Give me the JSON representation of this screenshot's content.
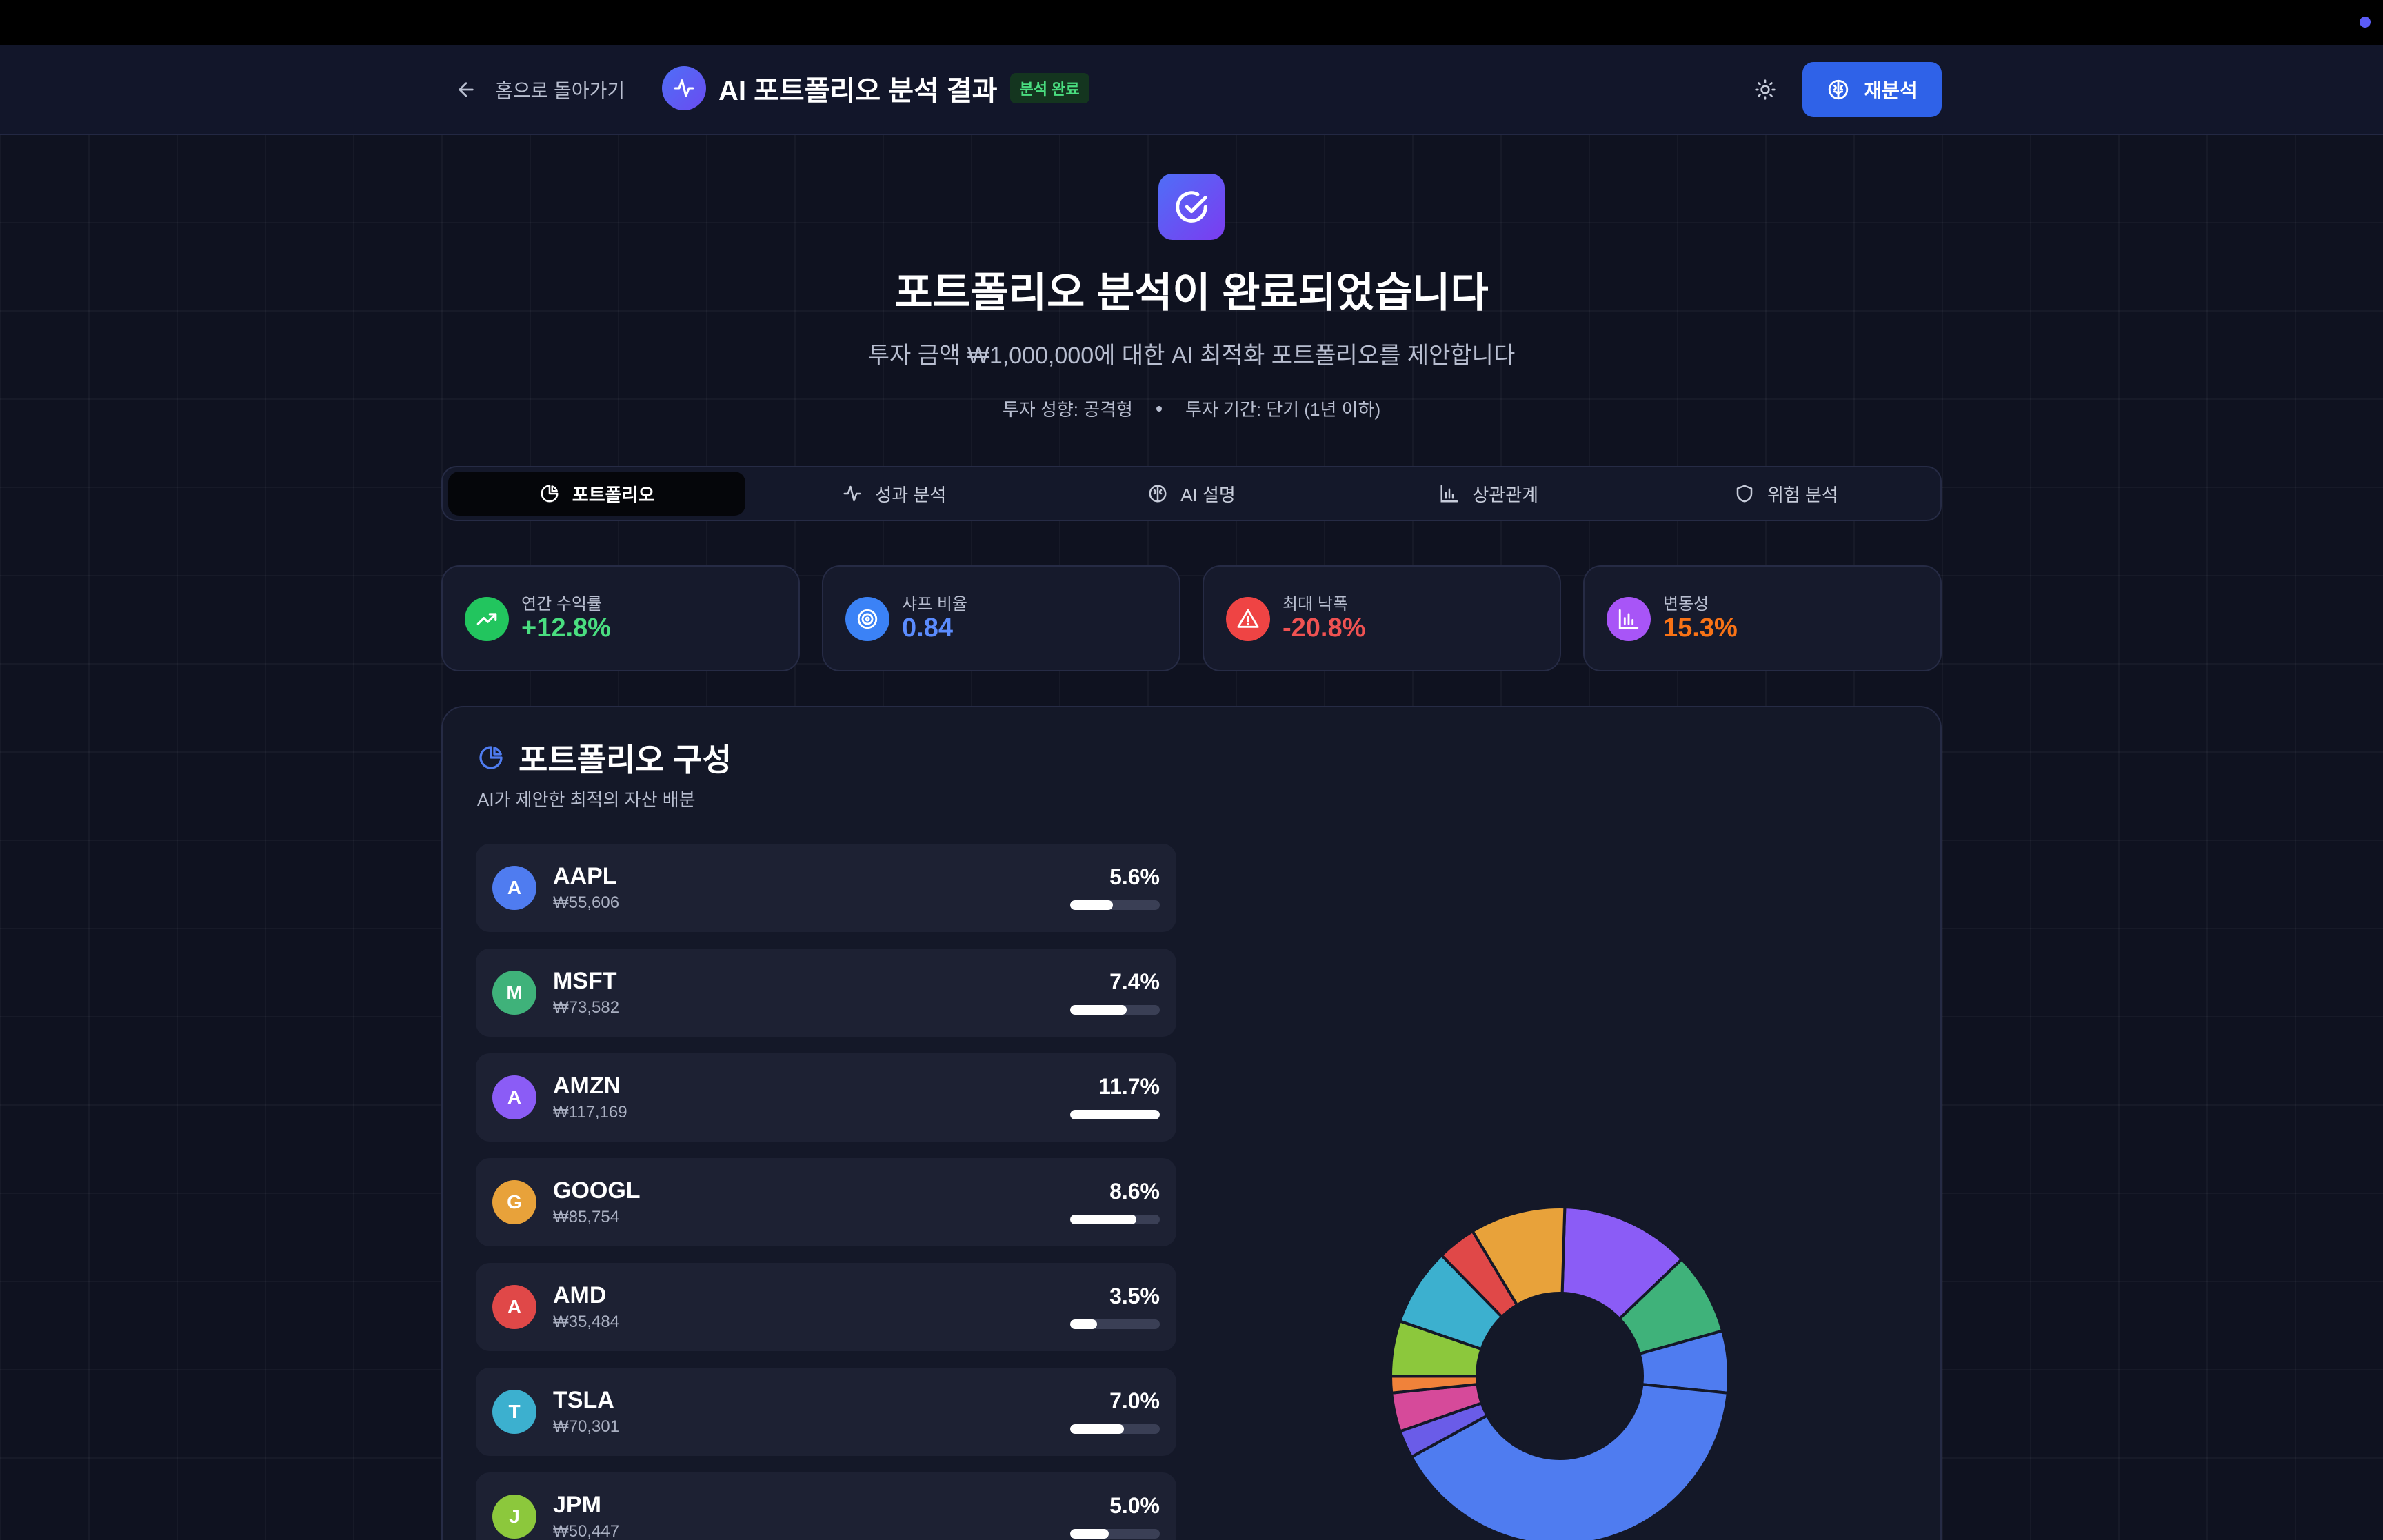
{
  "header": {
    "back_label": "홈으로 돌아가기",
    "title": "AI 포트폴리오 분석 결과",
    "status_badge": "분석 완료",
    "reanalyze_label": "재분석"
  },
  "hero": {
    "title": "포트폴리오 분석이 완료되었습니다",
    "subtitle": "투자 금액 ₩1,000,000에 대한 AI 최적화 포트폴리오를 제안합니다",
    "risk_profile": "투자 성향: 공격형",
    "horizon": "투자 기간: 단기 (1년 이하)"
  },
  "tabs": [
    {
      "label": "포트폴리오",
      "icon": "pie-chart-icon",
      "active": true
    },
    {
      "label": "성과 분석",
      "icon": "activity-icon",
      "active": false
    },
    {
      "label": "AI 설명",
      "icon": "brain-icon",
      "active": false
    },
    {
      "label": "상관관계",
      "icon": "bar-chart-icon",
      "active": false
    },
    {
      "label": "위험 분석",
      "icon": "shield-icon",
      "active": false
    }
  ],
  "metrics": [
    {
      "label": "연간 수익률",
      "value": "+12.8%",
      "color": "#4ade80",
      "icon_bg": "#22c55e",
      "icon": "trending-up-icon"
    },
    {
      "label": "샤프 비율",
      "value": "0.84",
      "color": "#5b8cff",
      "icon_bg": "#3b82f6",
      "icon": "target-icon"
    },
    {
      "label": "최대 낙폭",
      "value": "-20.8%",
      "color": "#f05252",
      "icon_bg": "#ef4444",
      "icon": "alert-triangle-icon"
    },
    {
      "label": "변동성",
      "value": "15.3%",
      "color": "#f97316",
      "icon_bg": "#a855f7",
      "icon": "bar-chart-icon"
    }
  ],
  "composition": {
    "title": "포트폴리오 구성",
    "subtitle": "AI가 제안한 최적의 자산 배분",
    "holdings": [
      {
        "initial": "A",
        "ticker": "AAPL",
        "amount": "₩55,606",
        "percent": "5.6%",
        "weight": 5.6,
        "color": "#4f7cf0"
      },
      {
        "initial": "M",
        "ticker": "MSFT",
        "amount": "₩73,582",
        "percent": "7.4%",
        "weight": 7.4,
        "color": "#3fb27a"
      },
      {
        "initial": "A",
        "ticker": "AMZN",
        "amount": "₩117,169",
        "percent": "11.7%",
        "weight": 11.7,
        "color": "#8b5cf6"
      },
      {
        "initial": "G",
        "ticker": "GOOGL",
        "amount": "₩85,754",
        "percent": "8.6%",
        "weight": 8.6,
        "color": "#e8a23a"
      },
      {
        "initial": "A",
        "ticker": "AMD",
        "amount": "₩35,484",
        "percent": "3.5%",
        "weight": 3.5,
        "color": "#e04848"
      },
      {
        "initial": "T",
        "ticker": "TSLA",
        "amount": "₩70,301",
        "percent": "7.0%",
        "weight": 7.0,
        "color": "#3cb0cf"
      },
      {
        "initial": "J",
        "ticker": "JPM",
        "amount": "₩50,447",
        "percent": "5.0%",
        "weight": 5.0,
        "color": "#8cc83c"
      }
    ]
  },
  "chart_data": {
    "type": "pie",
    "slices": [
      {
        "value": 11.7,
        "color": "#8b5cf6"
      },
      {
        "value": 7.4,
        "color": "#3fb27a"
      },
      {
        "value": 5.6,
        "color": "#4f7cf0"
      },
      {
        "value": 38.2,
        "color": "#4f7cf0"
      },
      {
        "value": 2.5,
        "color": "#6a5ce8"
      },
      {
        "value": 3.5,
        "color": "#d64a9a"
      },
      {
        "value": 1.5,
        "color": "#f0823a"
      },
      {
        "value": 5.0,
        "color": "#8cc83c"
      },
      {
        "value": 7.0,
        "color": "#3cb0cf"
      },
      {
        "value": 3.5,
        "color": "#e04848"
      },
      {
        "value": 8.6,
        "color": "#e8a23a"
      }
    ]
  }
}
